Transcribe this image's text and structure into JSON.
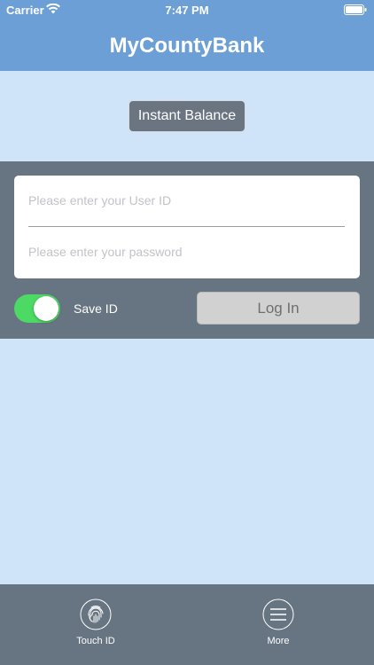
{
  "status_bar": {
    "carrier": "Carrier",
    "time": "7:47 PM",
    "wifi_icon": "wifi-icon",
    "battery_icon": "battery-icon"
  },
  "header": {
    "title": "MyCountyBank",
    "color": "#6b9fd6"
  },
  "instant_balance": {
    "label": "Instant Balance"
  },
  "login": {
    "user_id_placeholder": "Please enter your User ID",
    "user_id_value": "",
    "password_placeholder": "Please enter your password",
    "password_value": "",
    "save_id_label": "Save ID",
    "save_id_on": true,
    "login_label": "Log In"
  },
  "tab_bar": {
    "items": [
      {
        "label": "Touch ID",
        "icon": "fingerprint-icon"
      },
      {
        "label": "More",
        "icon": "menu-icon"
      }
    ]
  },
  "colors": {
    "background": "#cfe4f8",
    "panel": "#677481",
    "toggle_on": "#4cd964"
  }
}
